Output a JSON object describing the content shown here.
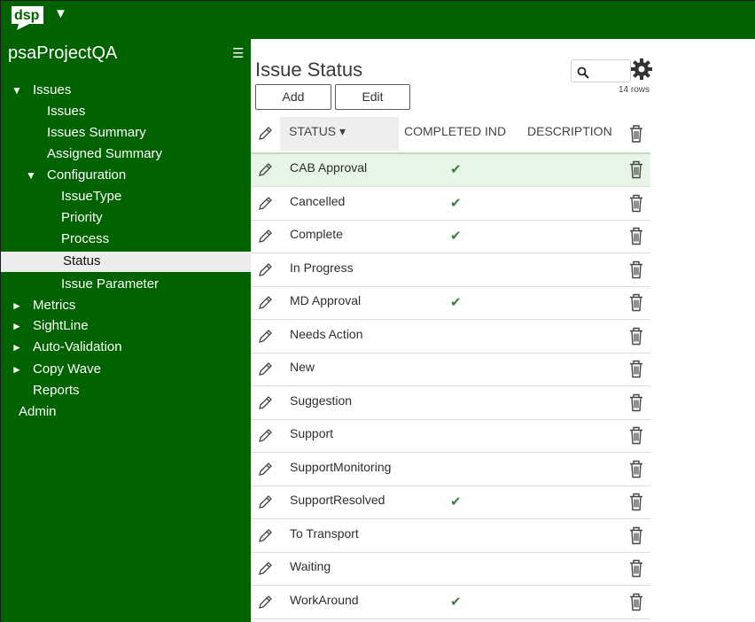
{
  "app": {
    "logo_text": "dsp",
    "project_name": "psaProjectQA"
  },
  "sidebar": {
    "items": [
      {
        "label": "Issues",
        "arrow": "▼",
        "level": 0,
        "expanded": true
      },
      {
        "label": "Issues",
        "arrow": "",
        "level": 1
      },
      {
        "label": "Issues Summary",
        "arrow": "",
        "level": 1
      },
      {
        "label": "Assigned Summary",
        "arrow": "",
        "level": 1
      },
      {
        "label": "Configuration",
        "arrow": "▼",
        "level": 1,
        "expanded": true
      },
      {
        "label": "IssueType",
        "arrow": "",
        "level": 2
      },
      {
        "label": "Priority",
        "arrow": "",
        "level": 2
      },
      {
        "label": "Process",
        "arrow": "",
        "level": 2
      },
      {
        "label": "Status",
        "arrow": "",
        "level": 2,
        "selected": true
      },
      {
        "label": "Issue Parameter",
        "arrow": "",
        "level": 2
      },
      {
        "label": "Metrics",
        "arrow": "►",
        "level": 0
      },
      {
        "label": "SightLine",
        "arrow": "►",
        "level": 0
      },
      {
        "label": "Auto-Validation",
        "arrow": "►",
        "level": 0
      },
      {
        "label": "Copy Wave",
        "arrow": "►",
        "level": 0
      },
      {
        "label": "Reports",
        "arrow": "",
        "level": 0
      },
      {
        "label": "Admin",
        "arrow": "",
        "level": -1
      }
    ]
  },
  "main": {
    "title": "Issue Status",
    "add_label": "Add",
    "edit_label": "Edit",
    "rows_count": "14 rows",
    "columns": {
      "status": "STATUS ▾",
      "completed": "COMPLETED IND",
      "description": "DESCRIPTION"
    },
    "check_glyph": "✔",
    "rows": [
      {
        "status": "CAB Approval",
        "completed": true,
        "description": ""
      },
      {
        "status": "Cancelled",
        "completed": true,
        "description": ""
      },
      {
        "status": "Complete",
        "completed": true,
        "description": ""
      },
      {
        "status": "In Progress",
        "completed": false,
        "description": ""
      },
      {
        "status": "MD Approval",
        "completed": true,
        "description": ""
      },
      {
        "status": "Needs Action",
        "completed": false,
        "description": ""
      },
      {
        "status": "New",
        "completed": false,
        "description": ""
      },
      {
        "status": "Suggestion",
        "completed": false,
        "description": ""
      },
      {
        "status": "Support",
        "completed": false,
        "description": ""
      },
      {
        "status": "SupportMonitoring",
        "completed": false,
        "description": ""
      },
      {
        "status": "SupportResolved",
        "completed": true,
        "description": ""
      },
      {
        "status": "To Transport",
        "completed": false,
        "description": ""
      },
      {
        "status": "Waiting",
        "completed": false,
        "description": ""
      },
      {
        "status": "WorkAround",
        "completed": true,
        "description": ""
      }
    ]
  },
  "colors": {
    "brand_green": "#016300",
    "row_highlight": "#e6f5e6",
    "check_green": "#3e7d3e"
  },
  "icons": [
    "dsp-logo-icon",
    "dropdown-caret-icon",
    "hamburger-menu-icon",
    "search-icon",
    "gear-icon",
    "edit-pencil-icon",
    "trash-icon",
    "expand-arrow-icon",
    "collapse-arrow-icon",
    "checkmark-icon"
  ]
}
